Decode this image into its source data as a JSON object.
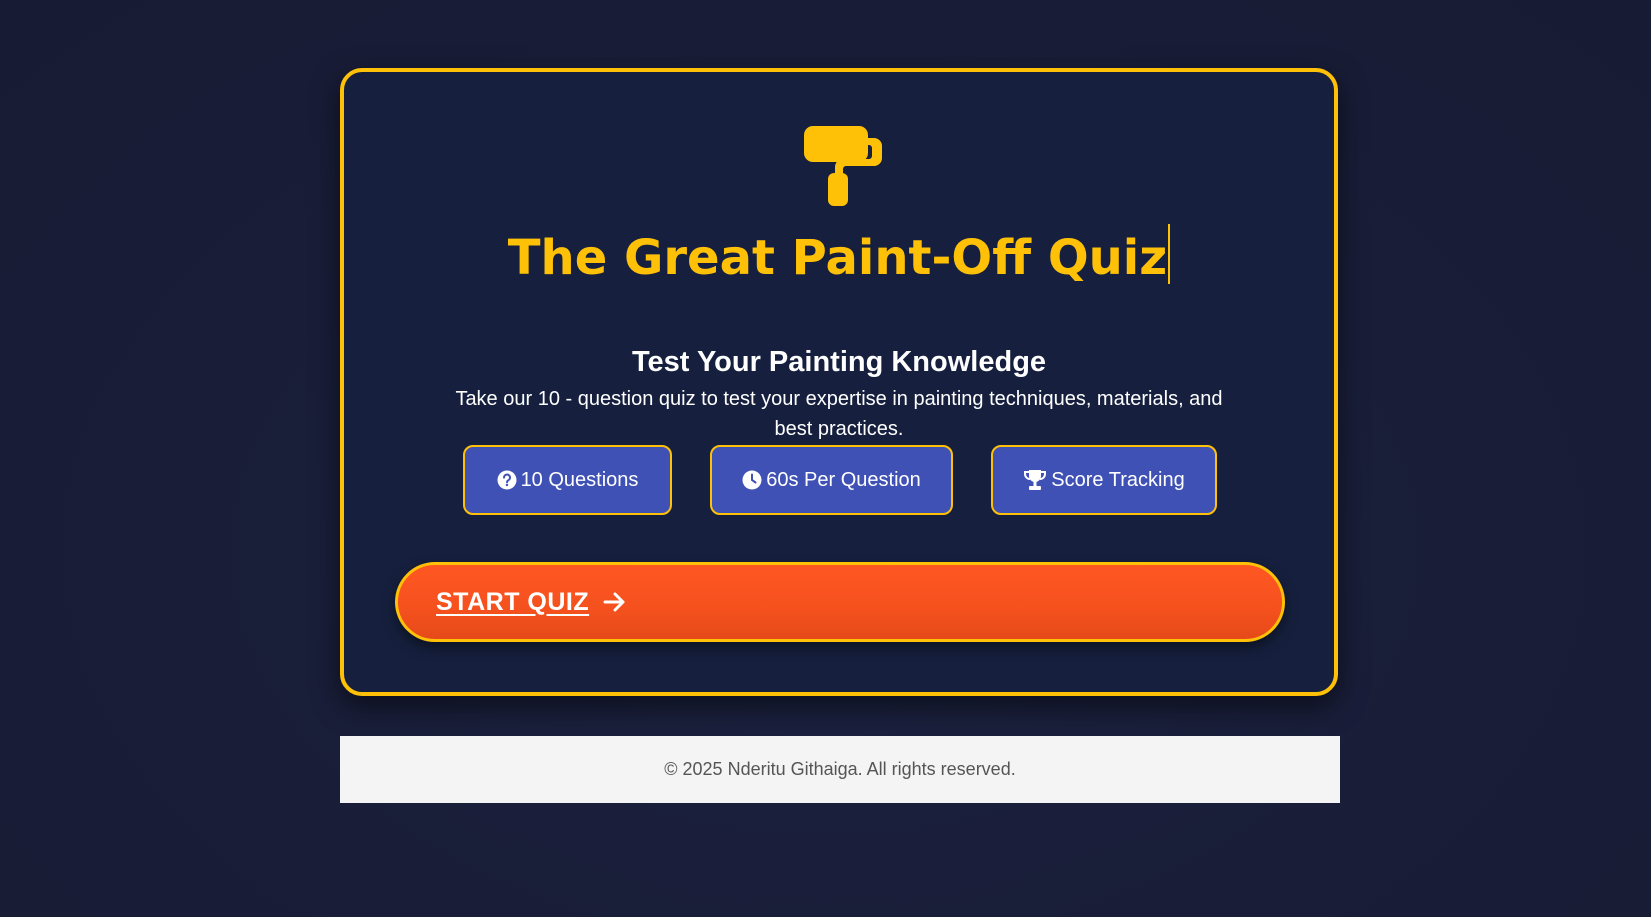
{
  "quiz": {
    "title": "The Great Paint-Off Quiz",
    "subtitle": "Test Your Painting Knowledge",
    "description": "Take our 10 - question quiz to test your expertise in painting techniques, materials, and best practices.",
    "features": [
      {
        "icon": "question-circle-icon",
        "label": "10 Questions"
      },
      {
        "icon": "clock-icon",
        "label": "60s Per Question"
      },
      {
        "icon": "trophy-icon",
        "label": "Score Tracking"
      }
    ],
    "start_button": {
      "label": "START QUIZ",
      "icon": "arrow-right-icon"
    },
    "logo_icon": "paint-roller-icon"
  },
  "footer": {
    "text": "© 2025 Nderitu Githaiga. All rights reserved."
  },
  "colors": {
    "background": "#191d38",
    "card": "#16203e",
    "accent": "#ffc107",
    "feature": "#3f51b5",
    "start": "#ff5722",
    "footer": "#f4f4f4"
  }
}
